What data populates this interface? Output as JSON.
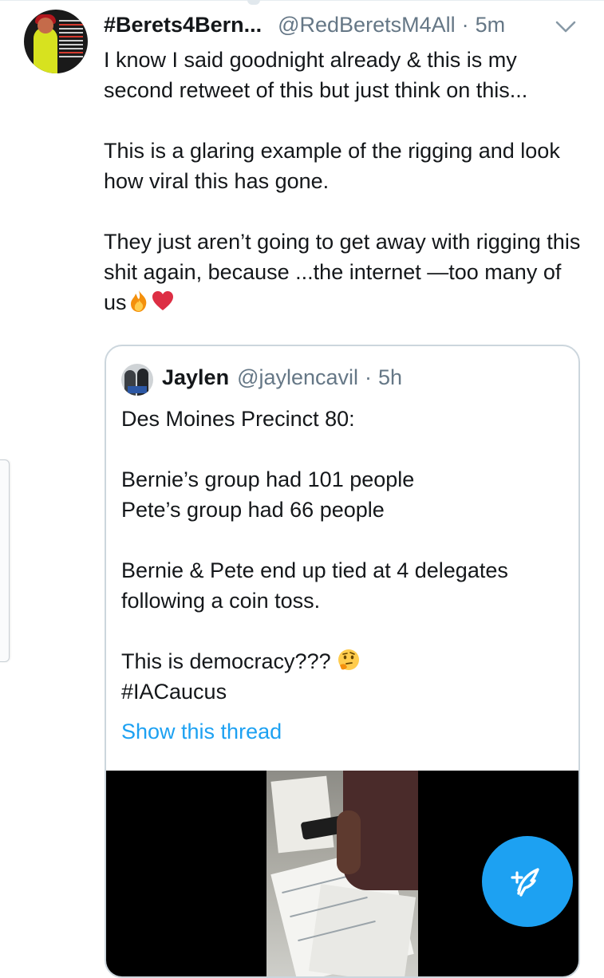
{
  "tweet": {
    "author_name": "#Berets4Bern...",
    "author_handle": "@RedBeretsM4All",
    "separator": "·",
    "time": "5m",
    "paragraphs": [
      "I know I said goodnight already & this is my second retweet of this but just think on this...",
      "This is a glaring example of the rigging and look how viral this has gone.",
      "They just aren’t going to get away with rigging this shit again, because ...the internet —too many of us"
    ],
    "trailing_emoji": [
      "fire",
      "red-heart"
    ],
    "menu_icon": "chevron-down-icon"
  },
  "quoted_tweet": {
    "author_name": "Jaylen",
    "author_handle": "@jaylencavil",
    "separator": "·",
    "time": "5h",
    "lines": {
      "l1": "Des Moines Precinct 80:",
      "l2": "Bernie’s group had 101 people",
      "l3": "Pete’s group had 66 people",
      "l4": "Bernie & Pete end up tied at 4 delegates following a coin toss.",
      "l5": "This is democracy???",
      "l6": "#IACaucus"
    },
    "l5_emoji": "thinking-face",
    "show_thread": "Show this thread",
    "media": "video-still"
  },
  "compose_button": {
    "icon": "compose-feather-icon",
    "color": "#1da1f2"
  },
  "colors": {
    "text": "#14171a",
    "secondary": "#657786",
    "link": "#1da1f2",
    "border": "#ccd6dd"
  }
}
